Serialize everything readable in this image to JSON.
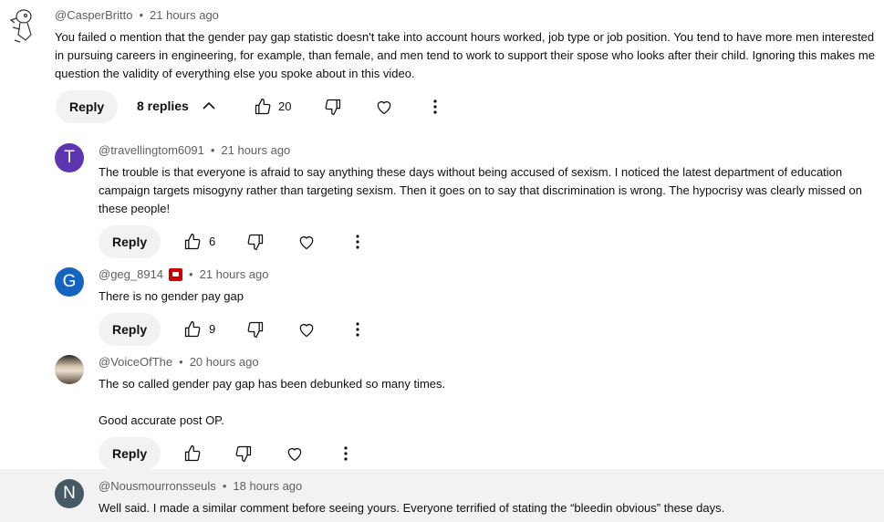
{
  "reply_label": "Reply",
  "main": {
    "handle": "@CasperBritto",
    "time": "21 hours ago",
    "text": "You failed o mention that the gender pay gap statistic doesn't take into account hours worked, job type or job position. You tend to have more men interested in pursuing careers in engineering, for example, than female, and men tend to work to support their spose who looks after their child. Ignoring this makes me question the validity of everything else you spoke about in this video.",
    "replies_label": "8 replies",
    "likes": "20"
  },
  "replies": [
    {
      "handle": "@travellingtom6091",
      "time": "21 hours ago",
      "avatar_letter": "T",
      "avatar_color": "#5e35b1",
      "lines": [
        "The trouble is that everyone is afraid to say anything these days without being accused of sexism. I noticed the latest department of education campaign targets misogyny rather than targeting sexism. Then it goes on to say that discrimination is wrong. The hypocrisy was clearly missed on these people!"
      ],
      "likes": "6"
    },
    {
      "handle": "@geg_8914",
      "time": "21 hours ago",
      "avatar_letter": "G",
      "avatar_color": "#1565c0",
      "lines": [
        "There is no gender pay gap"
      ],
      "likes": "9"
    },
    {
      "handle": "@VoiceOfThe",
      "time": "20 hours ago",
      "lines": [
        "The so called gender pay gap has been debunked so many times.",
        "Good accurate post OP."
      ],
      "likes": ""
    },
    {
      "handle": "@Nousmourronsseuls",
      "time": "18 hours ago",
      "avatar_letter": "N",
      "avatar_color": "#455a64",
      "lines": [
        "Well said. I made a similar comment before seeing yours. Everyone terrified of stating the “bleedin obvious” these days."
      ]
    }
  ]
}
